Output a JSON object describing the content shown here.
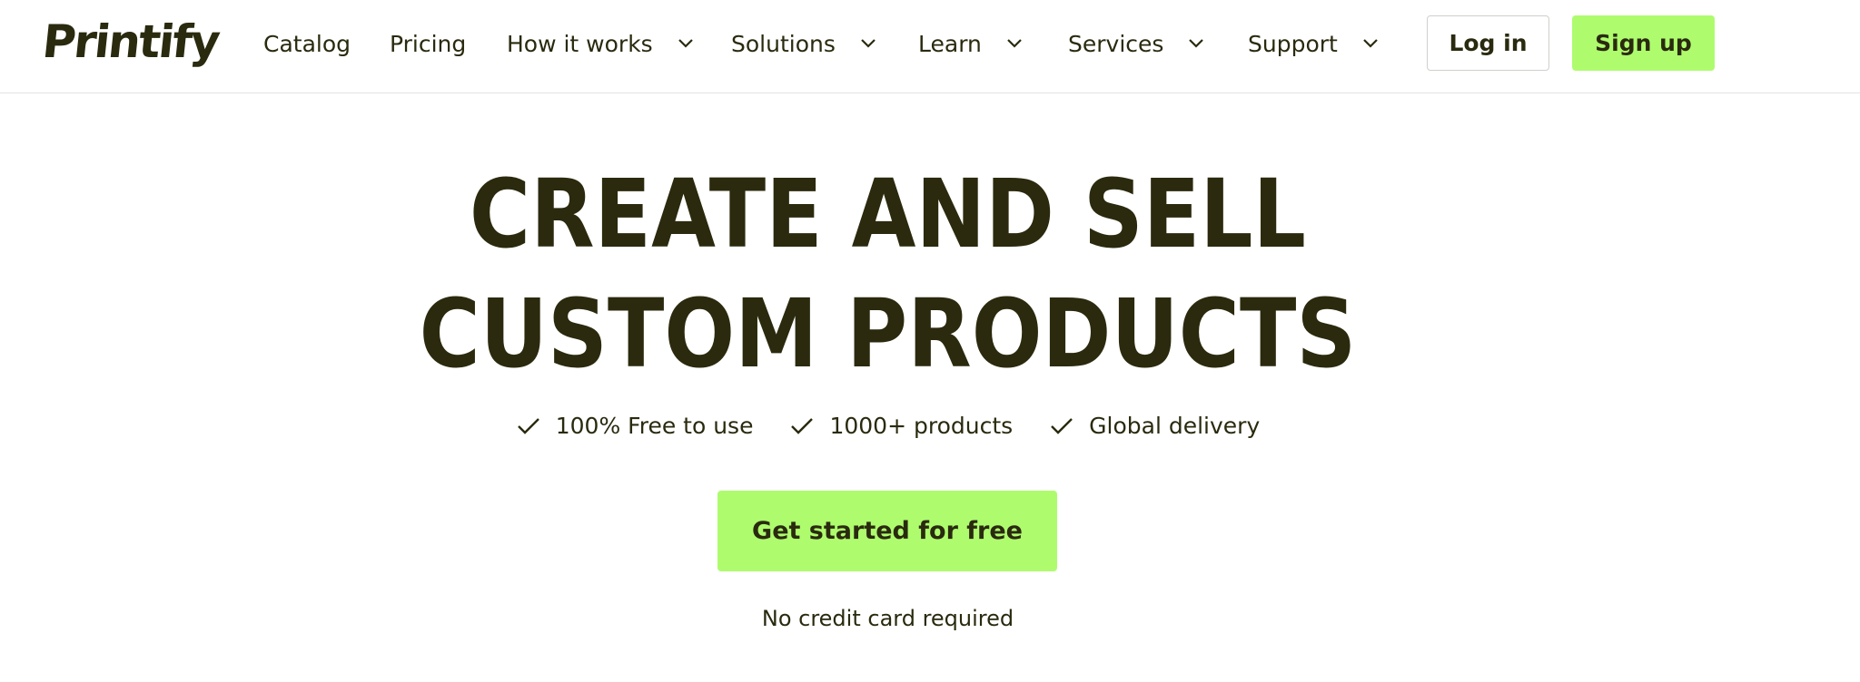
{
  "header": {
    "logo_text": "Printify",
    "nav": [
      {
        "label": "Catalog",
        "has_dropdown": false
      },
      {
        "label": "Pricing",
        "has_dropdown": false
      },
      {
        "label": "How it works",
        "has_dropdown": true
      },
      {
        "label": "Solutions",
        "has_dropdown": true
      },
      {
        "label": "Learn",
        "has_dropdown": true
      },
      {
        "label": "Services",
        "has_dropdown": true
      },
      {
        "label": "Support",
        "has_dropdown": true
      }
    ],
    "login_label": "Log in",
    "signup_label": "Sign up"
  },
  "hero": {
    "title_line1": "CREATE AND SELL",
    "title_line2": "CUSTOM PRODUCTS",
    "features": [
      {
        "icon": "check-icon",
        "label": "100% Free to use"
      },
      {
        "icon": "check-icon",
        "label": "1000+ products"
      },
      {
        "icon": "check-icon",
        "label": "Global delivery"
      }
    ],
    "cta_label": "Get started for free",
    "note": "No credit card required"
  },
  "colors": {
    "accent": "#aefc6e",
    "text": "#2a2a0f",
    "border": "#e3e3de"
  }
}
